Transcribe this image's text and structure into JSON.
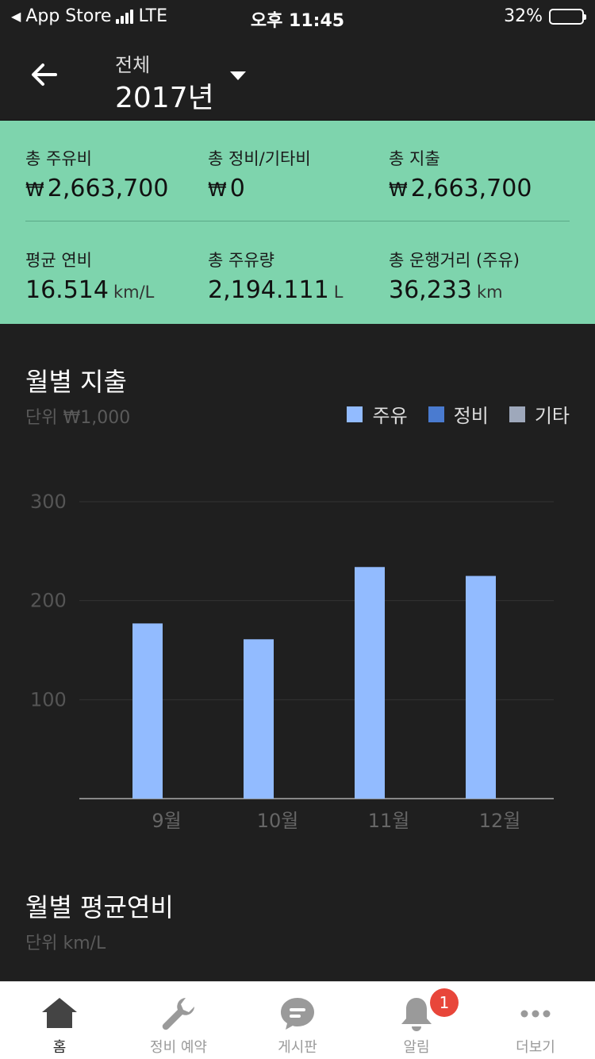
{
  "statusbar": {
    "carrier": "App Store",
    "network": "LTE",
    "time": "오후 11:45",
    "battery": "32%",
    "battery_level": 0.32
  },
  "header": {
    "filter_label": "전체",
    "year_label": "2017년"
  },
  "stats": {
    "items": [
      {
        "label": "총 주유비",
        "currency": "₩",
        "value": "2,663,700",
        "unit": ""
      },
      {
        "label": "총 정비/기타비",
        "currency": "₩",
        "value": "0",
        "unit": ""
      },
      {
        "label": "총 지출",
        "currency": "₩",
        "value": "2,663,700",
        "unit": ""
      },
      {
        "label": "평균 연비",
        "currency": "",
        "value": "16.514",
        "unit": "km/L"
      },
      {
        "label": "총 주유량",
        "currency": "",
        "value": "2,194.111",
        "unit": "L"
      },
      {
        "label": "총 운행거리 (주유)",
        "currency": "",
        "value": "36,233",
        "unit": "km"
      }
    ]
  },
  "monthly_expense": {
    "title": "월별 지출",
    "unit": "단위 ₩1,000"
  },
  "monthly_efficiency": {
    "title": "월별 평균연비",
    "unit": "단위 km/L"
  },
  "legend": [
    {
      "name": "주유",
      "color": "#92bbff"
    },
    {
      "name": "정비",
      "color": "#4a7bd0"
    },
    {
      "name": "기타",
      "color": "#9ea8bb"
    }
  ],
  "chart_data": {
    "type": "bar",
    "categories": [
      "9월",
      "10월",
      "11월",
      "12월"
    ],
    "series": [
      {
        "name": "주유",
        "values": [
          177,
          161,
          234,
          225
        ],
        "color": "#92bbff"
      },
      {
        "name": "정비",
        "values": [
          0,
          0,
          0,
          0
        ],
        "color": "#4a7bd0"
      },
      {
        "name": "기타",
        "values": [
          0,
          0,
          0,
          0
        ],
        "color": "#9ea8bb"
      }
    ],
    "y_ticks": [
      "100",
      "200",
      "300"
    ],
    "ylim": [
      0,
      300
    ],
    "grid": true
  },
  "tabbar": {
    "items": [
      {
        "label": "홈",
        "icon": "home-icon",
        "active": true
      },
      {
        "label": "정비 예약",
        "icon": "wrench-icon",
        "active": false
      },
      {
        "label": "게시판",
        "icon": "chat-bubble-icon",
        "active": false
      },
      {
        "label": "알림",
        "icon": "bell-icon",
        "active": false,
        "badge": "1"
      },
      {
        "label": "더보기",
        "icon": "more-dots-icon",
        "active": false
      }
    ]
  }
}
